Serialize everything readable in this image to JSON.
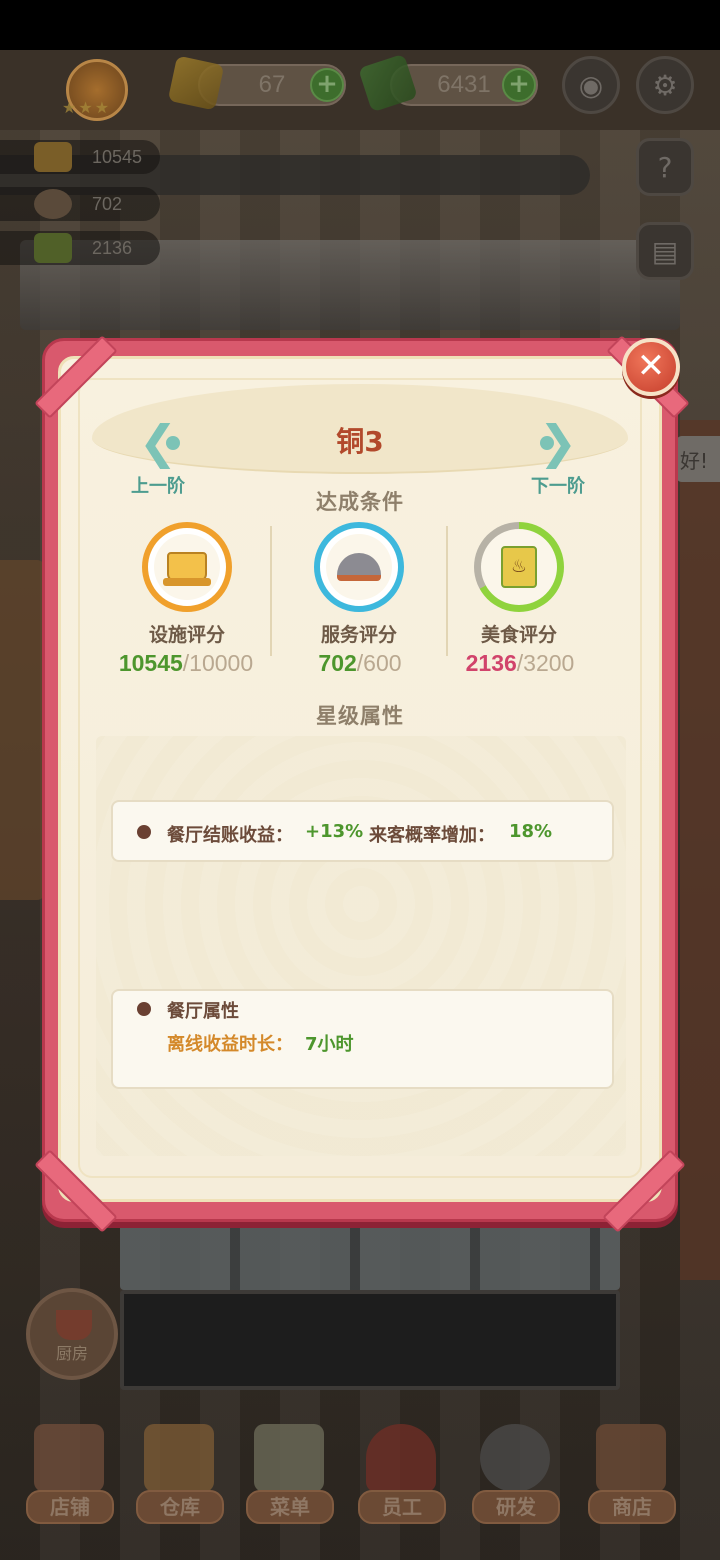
{
  "hud": {
    "gems": "67",
    "cash": "6431",
    "stats": [
      {
        "icon": "facility-icon",
        "value": "10545"
      },
      {
        "icon": "service-icon",
        "value": "702"
      },
      {
        "icon": "food-icon",
        "value": "2136"
      }
    ],
    "stars": "★★★",
    "background_greeting": "好!"
  },
  "modal": {
    "rank_title": "铜3",
    "prev_label": "上一阶",
    "next_label": "下一阶",
    "conditions_title": "达成条件",
    "metrics": [
      {
        "name": "设施评分",
        "current": "10545",
        "target": "/10000",
        "met": true
      },
      {
        "name": "服务评分",
        "current": "702",
        "target": "/600",
        "met": true
      },
      {
        "name": "美食评分",
        "current": "2136",
        "target": "/3200",
        "met": false,
        "progress": 0.67
      }
    ],
    "attrs_title": "星级属性",
    "star_attrs": {
      "label1": "餐厅结账收益：",
      "value1": "+13%",
      "label2": "来客概率增加：",
      "value2": "18%"
    },
    "restaurant_attrs": {
      "title": "餐厅属性",
      "label": "离线收益时长：",
      "value": "7小时"
    },
    "close_icon": "close-icon"
  },
  "nav": {
    "kitchen": "厨房",
    "items": [
      "店铺",
      "仓库",
      "菜单",
      "员工",
      "研发",
      "商店"
    ]
  },
  "colors": {
    "accent_red": "#d9596d",
    "title": "#b2492b",
    "ok": "#4d962d",
    "bad": "#d1436b",
    "teal": "#7cc3b6"
  }
}
